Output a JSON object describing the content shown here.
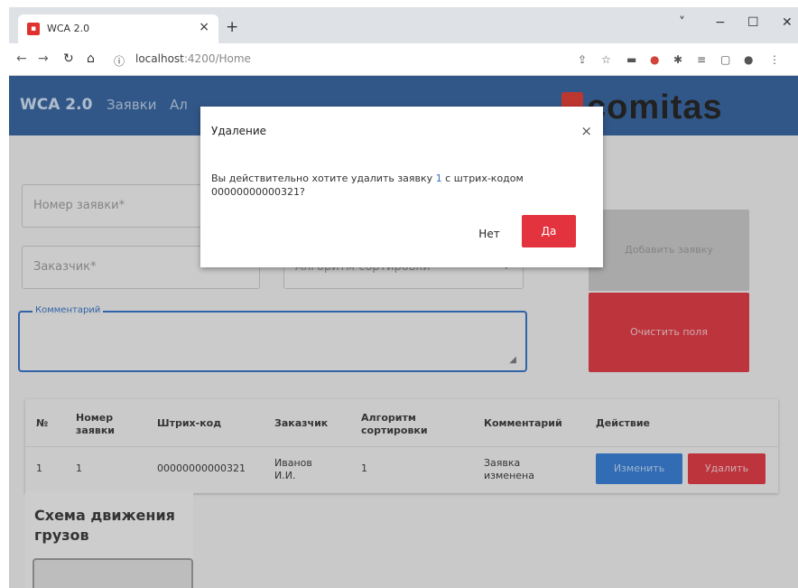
{
  "browser": {
    "tab_title": "WCA 2.0",
    "tab_close": "×",
    "new_tab": "+",
    "url_host": "localhost",
    "url_path": ":4200/Home",
    "win_min": "−",
    "win_max": "☐",
    "win_close": "✕",
    "chevron": "˅"
  },
  "header": {
    "brand": "WCA 2.0",
    "nav": [
      "Заявки",
      "Ал"
    ],
    "logo": "comitas"
  },
  "form": {
    "order_number_placeholder": "Номер заявки*",
    "customer_placeholder": "Заказчик*",
    "algorithm_placeholder": "Алгоритм сортировки*",
    "comment_label": "Комментарий",
    "add_button": "Добавить заявку",
    "clear_button": "Очистить поля"
  },
  "table": {
    "headers": [
      "№",
      "Номер заявки",
      "Штрих-код",
      "Заказчик",
      "Алгоритм сортировки",
      "Комментарий",
      "Действие"
    ],
    "rows": [
      {
        "n": "1",
        "order": "1",
        "barcode": "00000000000321",
        "customer": "Иванов И.И.",
        "algorithm": "1",
        "comment": "Заявка изменена"
      }
    ],
    "edit_button": "Изменить",
    "delete_button": "Удалить"
  },
  "schema": {
    "title": "Схема движения грузов"
  },
  "modal": {
    "title": "Удаление",
    "close": "×",
    "text_before": "Вы действительно хотите удалить заявку ",
    "order_num": "1",
    "text_after": " с штрих-кодом 00000000000321?",
    "no_button": "Нет",
    "yes_button": "Да"
  }
}
